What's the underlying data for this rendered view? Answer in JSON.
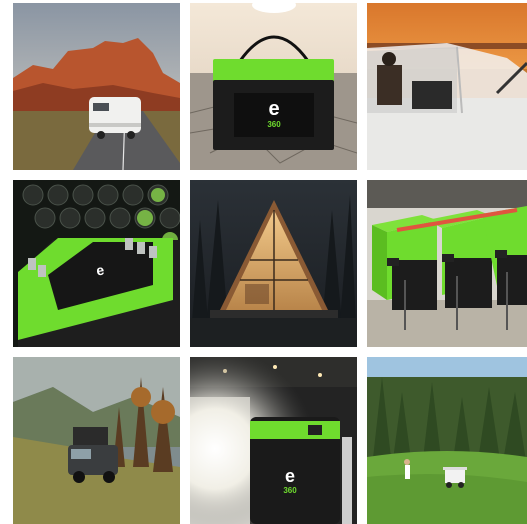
{
  "gallery": {
    "tiles": [
      {
        "subject": "rv-desert-road"
      },
      {
        "subject": "battery-on-dry-lakebed"
      },
      {
        "subject": "boat-at-sunset"
      },
      {
        "subject": "battery-closeup-cells"
      },
      {
        "subject": "a-frame-cabin-night"
      },
      {
        "subject": "battery-bank-row"
      },
      {
        "subject": "overland-truck-mountain"
      },
      {
        "subject": "power-station-garage"
      },
      {
        "subject": "golf-course-cart"
      }
    ],
    "brand_mark": "e",
    "brand_number": "360"
  },
  "colors": {
    "accent_green": "#6fdc2e",
    "battery_black": "#1c1c1c"
  }
}
